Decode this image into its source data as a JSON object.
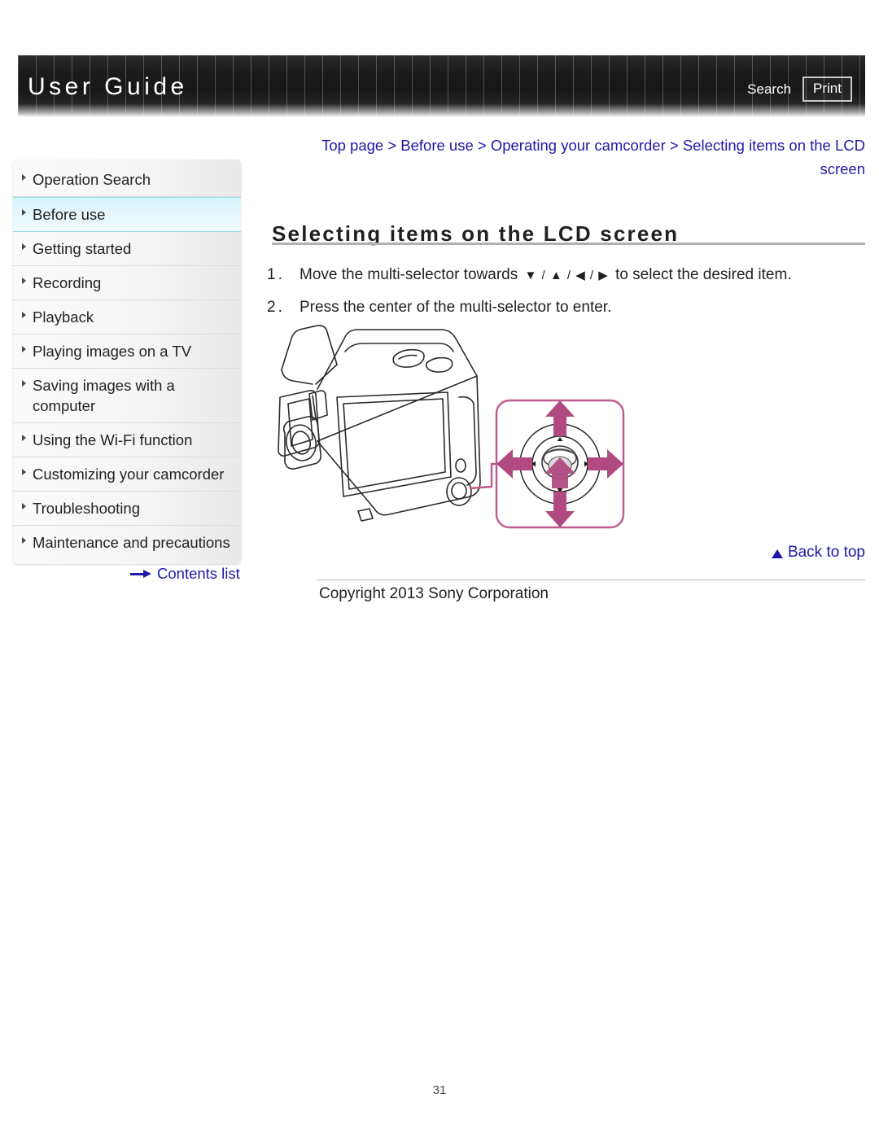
{
  "header": {
    "title": "User Guide",
    "search_label": "Search",
    "print_label": "Print"
  },
  "breadcrumb": {
    "text": "Top page > Before use > Operating your camcorder > Selecting items on the LCD screen"
  },
  "sidebar": {
    "items": [
      {
        "label": "Operation Search",
        "active": false
      },
      {
        "label": "Before use",
        "active": true
      },
      {
        "label": "Getting started",
        "active": false
      },
      {
        "label": "Recording",
        "active": false
      },
      {
        "label": "Playback",
        "active": false
      },
      {
        "label": "Playing images on a TV",
        "active": false
      },
      {
        "label": "Saving images with a computer",
        "active": false
      },
      {
        "label": "Using the Wi-Fi function",
        "active": false
      },
      {
        "label": "Customizing your camcorder",
        "active": false
      },
      {
        "label": "Troubleshooting",
        "active": false
      },
      {
        "label": "Maintenance and precautions",
        "active": false
      }
    ],
    "contents_list_label": "Contents list"
  },
  "main": {
    "heading": "Selecting items on the LCD screen",
    "steps": [
      {
        "num": "1.",
        "text_before": "Move the multi-selector towards",
        "glyphs": "▼ / ▲ / ◀ / ▶",
        "text_after": "to select the desired item."
      },
      {
        "num": "2.",
        "text_before": "Press the center of the multi-selector to enter.",
        "glyphs": "",
        "text_after": ""
      }
    ],
    "illustration_alt": "Camcorder with multi-selector callout showing four directional arrows"
  },
  "footer": {
    "back_to_top_label": "Back to top",
    "copyright": "Copyright 2013 Sony Corporation",
    "page_number": "31"
  },
  "colors": {
    "link_blue": "#2218a8",
    "accent_pink": "#c1588e",
    "header_dark": "#1b1b1b",
    "active_cyan": "#d5f3fb"
  }
}
